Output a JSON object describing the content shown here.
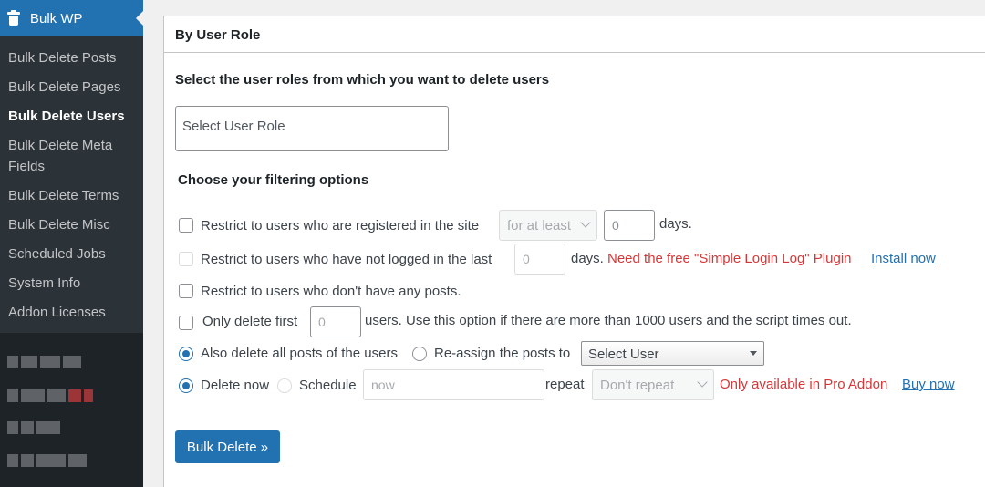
{
  "sidebar": {
    "title": "Bulk WP",
    "title_icon": "trash-icon",
    "items": [
      {
        "label": "Bulk Delete Posts"
      },
      {
        "label": "Bulk Delete Pages"
      },
      {
        "label": "Bulk Delete Users",
        "current": true
      },
      {
        "label": "Bulk Delete Meta Fields"
      },
      {
        "label": "Bulk Delete Terms"
      },
      {
        "label": "Bulk Delete Misc"
      },
      {
        "label": "Scheduled Jobs"
      },
      {
        "label": "System Info"
      },
      {
        "label": "Addon Licenses"
      }
    ]
  },
  "panel": {
    "title": "By User Role",
    "intro": "Select the user roles from which you want to delete users",
    "role_placeholder": "Select User Role",
    "filter_heading": "Choose your filtering options",
    "filters": {
      "registered": {
        "label": "Restrict to users who are registered in the site",
        "select_value": "for at least",
        "days_value": "0",
        "unit": "days."
      },
      "not_logged": {
        "label": "Restrict to users who have not logged in the last",
        "days_value": "0",
        "unit": "days.",
        "notice": "Need the free \"Simple Login Log\" Plugin",
        "link": "Install now"
      },
      "no_posts": {
        "label": "Restrict to users who don't have any posts."
      },
      "limit": {
        "label": "Only delete first",
        "value": "0",
        "suffix": "users. Use this option if there are more than 1000 users and the script times out."
      }
    },
    "posts_action": {
      "delete_label": "Also delete all posts of the users",
      "reassign_label": "Re-assign the posts to",
      "user_select": "Select User"
    },
    "schedule": {
      "delete_now_label": "Delete now",
      "schedule_label": "Schedule",
      "time_placeholder": "now",
      "repeat_label": "repeat",
      "repeat_value": "Don't repeat",
      "notice": "Only available in Pro Addon",
      "link": "Buy now"
    },
    "submit_label": "Bulk Delete »"
  },
  "colors": {
    "accent": "#2271b1",
    "sidebar_bg": "#1d2327",
    "submenu_bg": "#2c3338",
    "error": "#d63638"
  }
}
